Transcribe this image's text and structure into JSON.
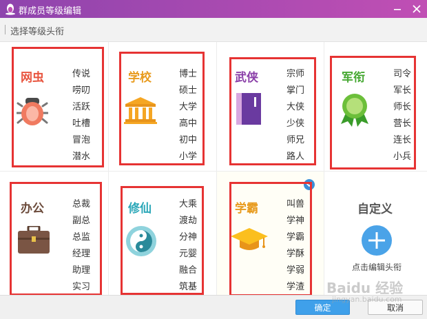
{
  "window": {
    "title": "群成员等级编辑"
  },
  "subheader": {
    "text": "选择等级头衔"
  },
  "categories": [
    {
      "name": "网虫",
      "color": "#e8543e",
      "icon": "bug-icon",
      "items": [
        "传说",
        "唠叨",
        "活跃",
        "吐槽",
        "冒泡",
        "潜水"
      ]
    },
    {
      "name": "学校",
      "color": "#e89b1e",
      "icon": "school-building-icon",
      "items": [
        "博士",
        "硕士",
        "大学",
        "高中",
        "初中",
        "小学"
      ]
    },
    {
      "name": "武侠",
      "color": "#8a3fa8",
      "icon": "martial-book-icon",
      "items": [
        "宗师",
        "掌门",
        "大侠",
        "少侠",
        "师兄",
        "路人"
      ]
    },
    {
      "name": "军衔",
      "color": "#46a832",
      "icon": "medal-icon",
      "items": [
        "司令",
        "军长",
        "师长",
        "营长",
        "连长",
        "小兵"
      ]
    },
    {
      "name": "办公",
      "color": "#6b4a3a",
      "icon": "briefcase-icon",
      "items": [
        "总裁",
        "副总",
        "总监",
        "经理",
        "助理",
        "实习"
      ]
    },
    {
      "name": "修仙",
      "color": "#2aa7b8",
      "icon": "taiji-icon",
      "items": [
        "大乘",
        "渡劫",
        "分神",
        "元婴",
        "融合",
        "筑基"
      ]
    },
    {
      "name": "学霸",
      "color": "#e89b1e",
      "icon": "graduation-cap-icon",
      "items": [
        "叫兽",
        "学神",
        "学霸",
        "学酥",
        "学弱",
        "学渣"
      ]
    }
  ],
  "custom": {
    "title": "自定义",
    "caption": "点击编辑头衔"
  },
  "footer": {
    "ok_label": "确定",
    "cancel_label": "取消"
  },
  "watermark": {
    "text1": "Baidu 经验",
    "text2": "jingyan.baidu.com"
  }
}
